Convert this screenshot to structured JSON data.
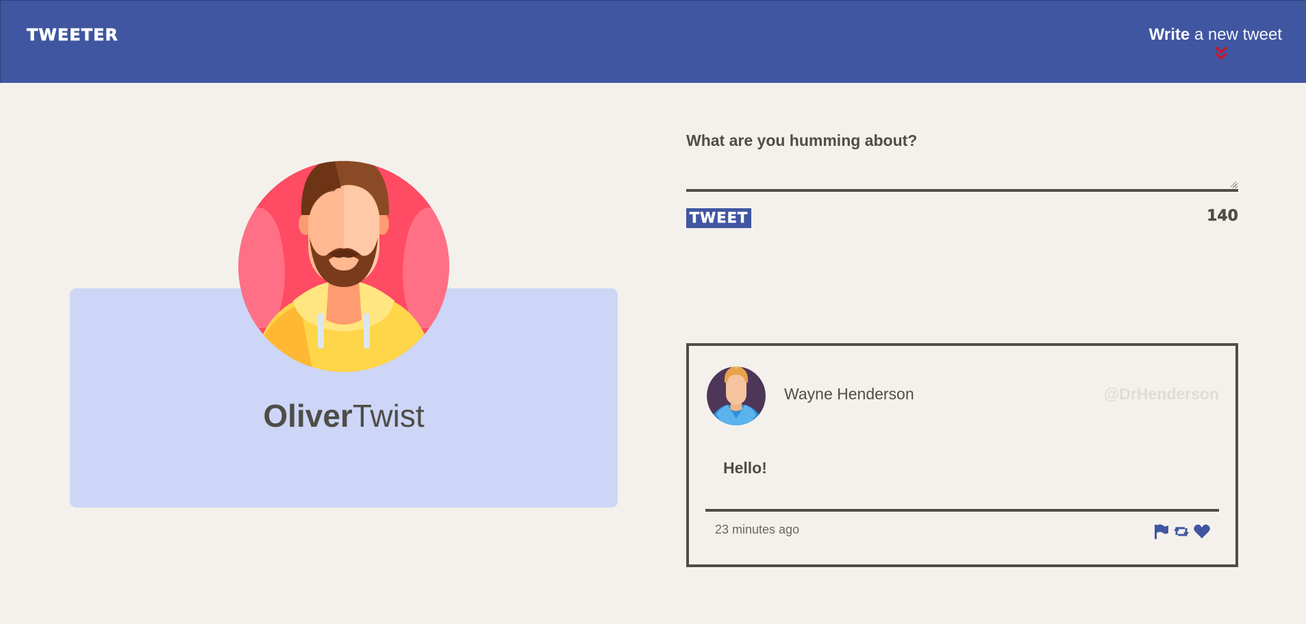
{
  "nav": {
    "brand": "TWEETER",
    "compose_bold": "Write",
    "compose_light": " a new tweet",
    "chevron_icon": "double-chevron-down-icon"
  },
  "profile": {
    "first_name": "Oliver",
    "last_name": "Twist",
    "avatar_icon": "bearded-man-avatar"
  },
  "compose": {
    "label": "What are you humming about?",
    "input_value": "",
    "button_label": "TWEET",
    "counter": "140"
  },
  "tweets": [
    {
      "author": "Wayne Henderson",
      "handle": "@DrHenderson",
      "content": "Hello!",
      "time": "23 minutes ago",
      "avatar_icon": "man-avatar",
      "actions": [
        "flag-icon",
        "retweet-icon",
        "heart-icon"
      ]
    }
  ],
  "colors": {
    "nav": "#4056a1",
    "background": "#f4f1ec",
    "profile_card": "#cdd6f6",
    "text": "#4f4d48",
    "accent_red": "#c0192f",
    "handle": "#e0dcd5"
  }
}
